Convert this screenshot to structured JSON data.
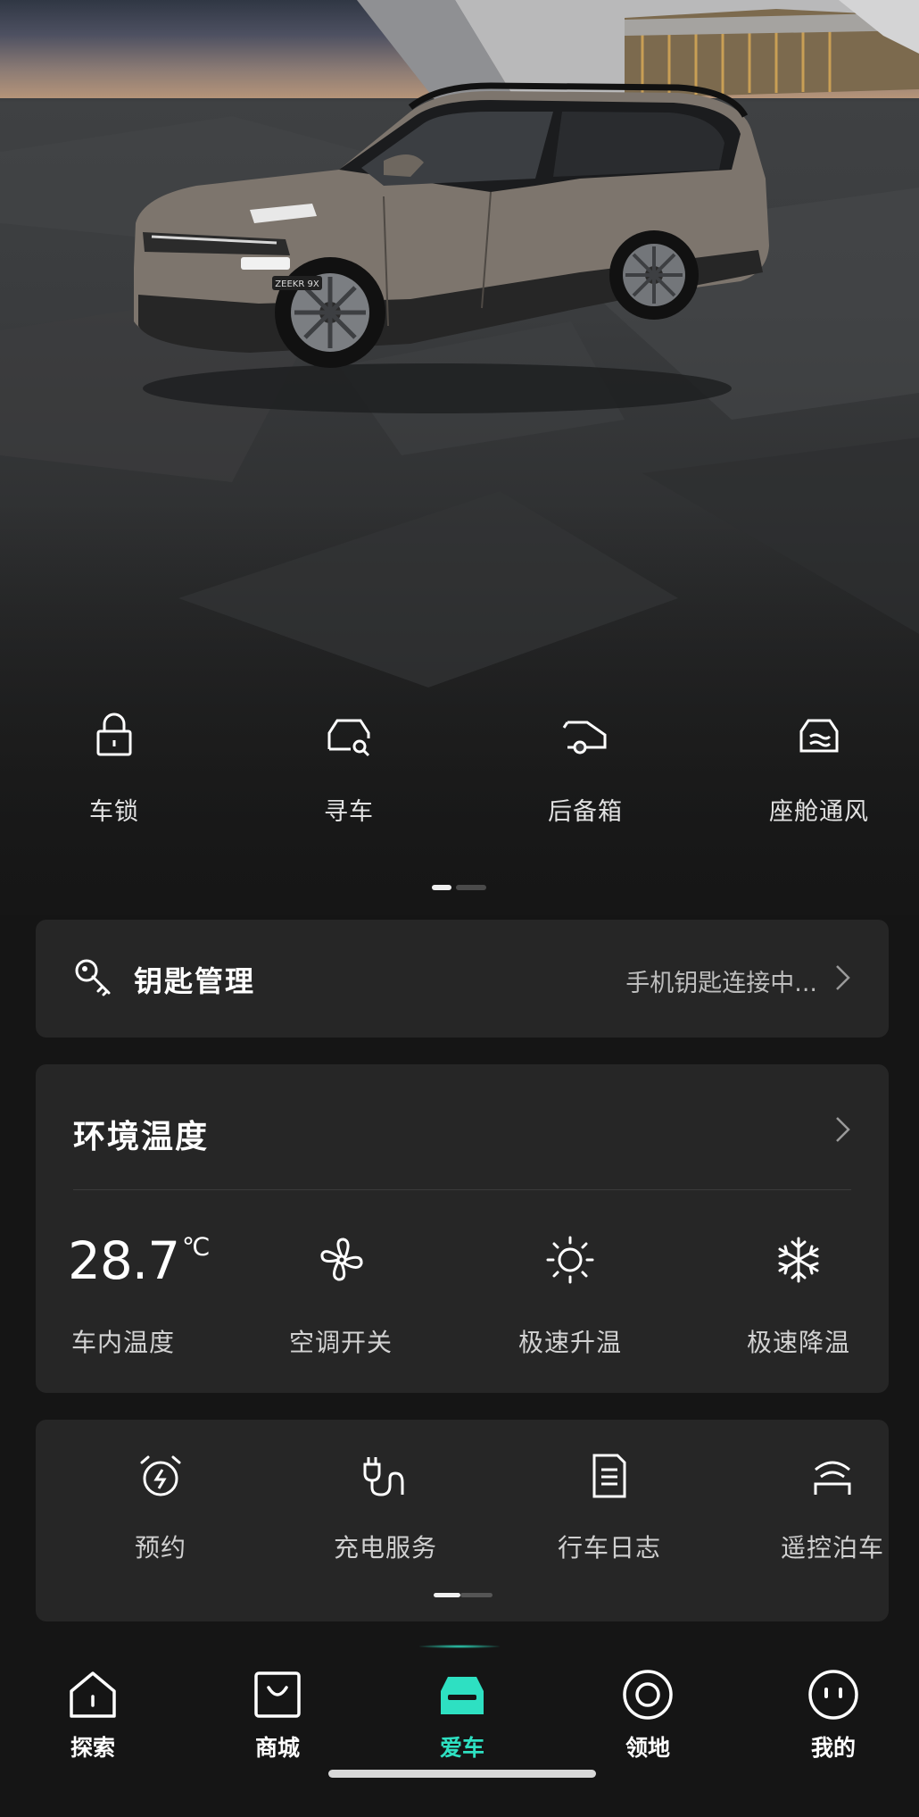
{
  "hero": {
    "car_badge_text": "ZEEKR 9X"
  },
  "quick_controls": [
    {
      "label": "车锁",
      "icon": "padlock-icon"
    },
    {
      "label": "寻车",
      "icon": "find-car-icon"
    },
    {
      "label": "后备箱",
      "icon": "trunk-icon"
    },
    {
      "label": "座舱通风",
      "icon": "cabin-ventilation-icon"
    }
  ],
  "key_management": {
    "title": "钥匙管理",
    "status": "手机钥匙连接中..."
  },
  "environment": {
    "title": "环境温度",
    "temperature_value": "28.7",
    "temperature_unit": "℃",
    "temperature_label": "车内温度",
    "controls": [
      {
        "label": "空调开关",
        "icon": "fan-icon"
      },
      {
        "label": "极速升温",
        "icon": "sun-icon"
      },
      {
        "label": "极速降温",
        "icon": "snowflake-icon"
      }
    ]
  },
  "services": [
    {
      "label": "预约",
      "icon": "alarm-clock-icon"
    },
    {
      "label": "充电服务",
      "icon": "charging-plug-icon"
    },
    {
      "label": "行车日志",
      "icon": "document-icon"
    },
    {
      "label": "遥控泊车",
      "icon": "remote-parking-icon"
    }
  ],
  "tabbar": {
    "tabs": [
      {
        "label": "探索",
        "icon": "house-icon",
        "active": false
      },
      {
        "label": "商城",
        "icon": "shopping-bag-icon",
        "active": false
      },
      {
        "label": "爱车",
        "icon": "car-icon",
        "active": true
      },
      {
        "label": "领地",
        "icon": "target-circle-icon",
        "active": false
      },
      {
        "label": "我的",
        "icon": "face-icon",
        "active": false
      }
    ],
    "accent_color": "#2ee0c2"
  }
}
